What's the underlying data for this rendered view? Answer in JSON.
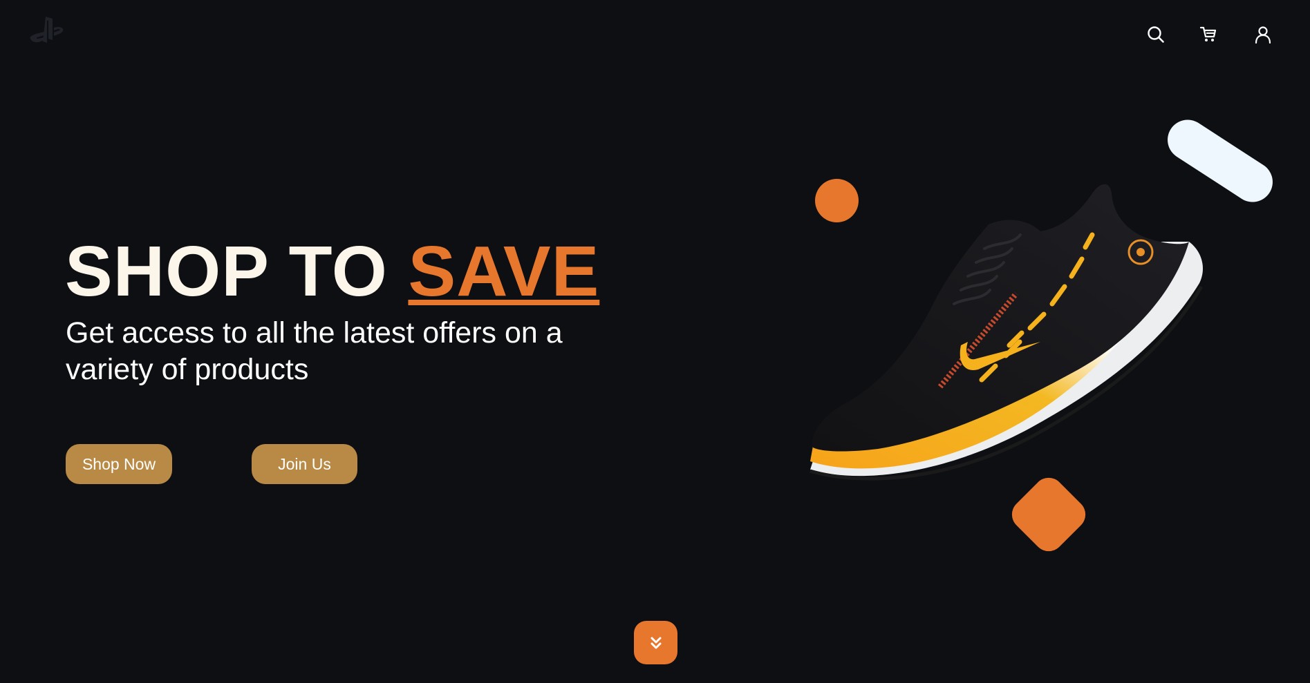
{
  "header": {
    "logo_icon": "playstation-logo-icon",
    "icons": [
      "search-icon",
      "cart-icon",
      "user-icon"
    ]
  },
  "hero": {
    "title_main": "SHOP TO ",
    "title_accent": "SAVE",
    "subtitle": "Get access to all the latest offers on a variety of products",
    "buttons": {
      "shop_now": "Shop Now",
      "join_us": "Join Us"
    }
  },
  "scroll": {
    "icon": "chevron-double-down-icon"
  },
  "colors": {
    "background": "#0e0f13",
    "accent": "#e8772e",
    "button": "#b98a45",
    "title": "#fbf5ea",
    "pill": "#eef6fe"
  }
}
